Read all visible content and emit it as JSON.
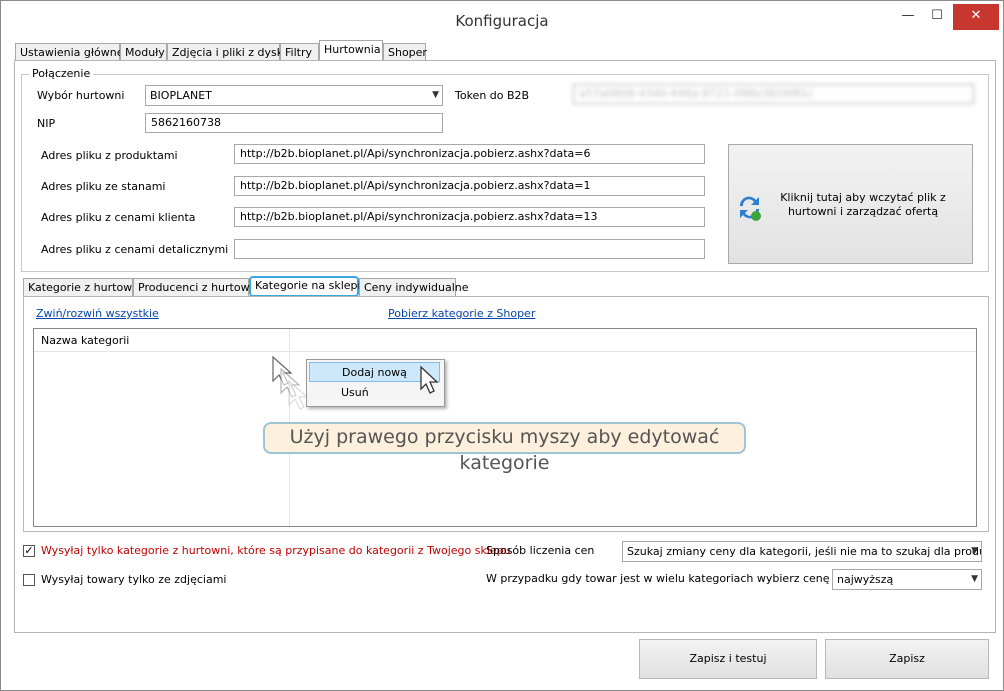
{
  "window": {
    "title": "Konfiguracja",
    "minimize_glyph": "—",
    "maximize_glyph": "☐",
    "close_glyph": "✕"
  },
  "main_tabs": [
    {
      "label": "Ustawienia główne"
    },
    {
      "label": "Moduły"
    },
    {
      "label": "Zdjęcia i pliki z dysku"
    },
    {
      "label": "Filtry"
    },
    {
      "label": "Hurtownia",
      "active": true
    },
    {
      "label": "Shoper"
    }
  ],
  "connection": {
    "group_label": "Połączenie",
    "wholesaler_label": "Wybór hurtowni",
    "wholesaler_value": "BIOPLANET",
    "nip_label": "NIP",
    "nip_value": "5862160738",
    "token_label": "Token do B2B",
    "token_value": "a57a0808-4340-448a-9721-098e3816f81c",
    "products_file_label": "Adres pliku z produktami",
    "products_file_value": "http://b2b.bioplanet.pl/Api/synchronizacja.pobierz.ashx?data=6",
    "stock_file_label": "Adres pliku ze stanami",
    "stock_file_value": "http://b2b.bioplanet.pl/Api/synchronizacja.pobierz.ashx?data=1",
    "client_prices_label": "Adres pliku z cenami klienta",
    "client_prices_value": "http://b2b.bioplanet.pl/Api/synchronizacja.pobierz.ashx?data=13",
    "retail_prices_label": "Adres pliku z cenami detalicznymi",
    "retail_prices_value": "",
    "load_button_label": "Kliknij tutaj aby wczytać plik z hurtowni i zarządzać ofertą",
    "load_button_icon": "refresh-arrows-icon"
  },
  "sub_tabs": [
    {
      "label": "Kategorie z hurtowni"
    },
    {
      "label": "Producenci z hurtowni"
    },
    {
      "label": "Kategorie na sklepie",
      "active": true
    },
    {
      "label": "Ceny indywidualne"
    }
  ],
  "categories": {
    "collapse_link": "Zwiń/rozwiń wszystkie",
    "fetch_link": "Pobierz kategorie z Shoper",
    "column_header": "Nazwa kategorii",
    "context_menu": [
      {
        "label": "Dodaj nową",
        "highlighted": true
      },
      {
        "label": "Usuń"
      }
    ],
    "hint": "Użyj prawego przycisku myszy aby edytować kategorie"
  },
  "options": {
    "send_only_mapped_label": "Wysyłaj tylko kategorie z hurtowni, które są przypisane do kategorii z Twojego sklepu",
    "send_only_mapped_checked": true,
    "send_with_photos_label": "Wysyłaj towary tylko ze zdjęciami",
    "send_with_photos_checked": false,
    "price_method_label": "Sposób liczenia cen",
    "price_method_value": "Szukaj zmiany ceny dla kategorii, jeśli nie ma to szukaj dla producenta",
    "multi_category_label": "W przypadku gdy towar jest w wielu kategoriach wybierz cenę",
    "multi_category_value": "najwyższą"
  },
  "footer": {
    "save_test_label": "Zapisz i testuj",
    "save_label": "Zapisz"
  },
  "colors": {
    "link": "#0645ad",
    "warning_text": "#c00000",
    "close_button": "#c7372f",
    "tooltip_bg": "#fdf0dc",
    "active_subtab_border": "#3aa7e0"
  }
}
